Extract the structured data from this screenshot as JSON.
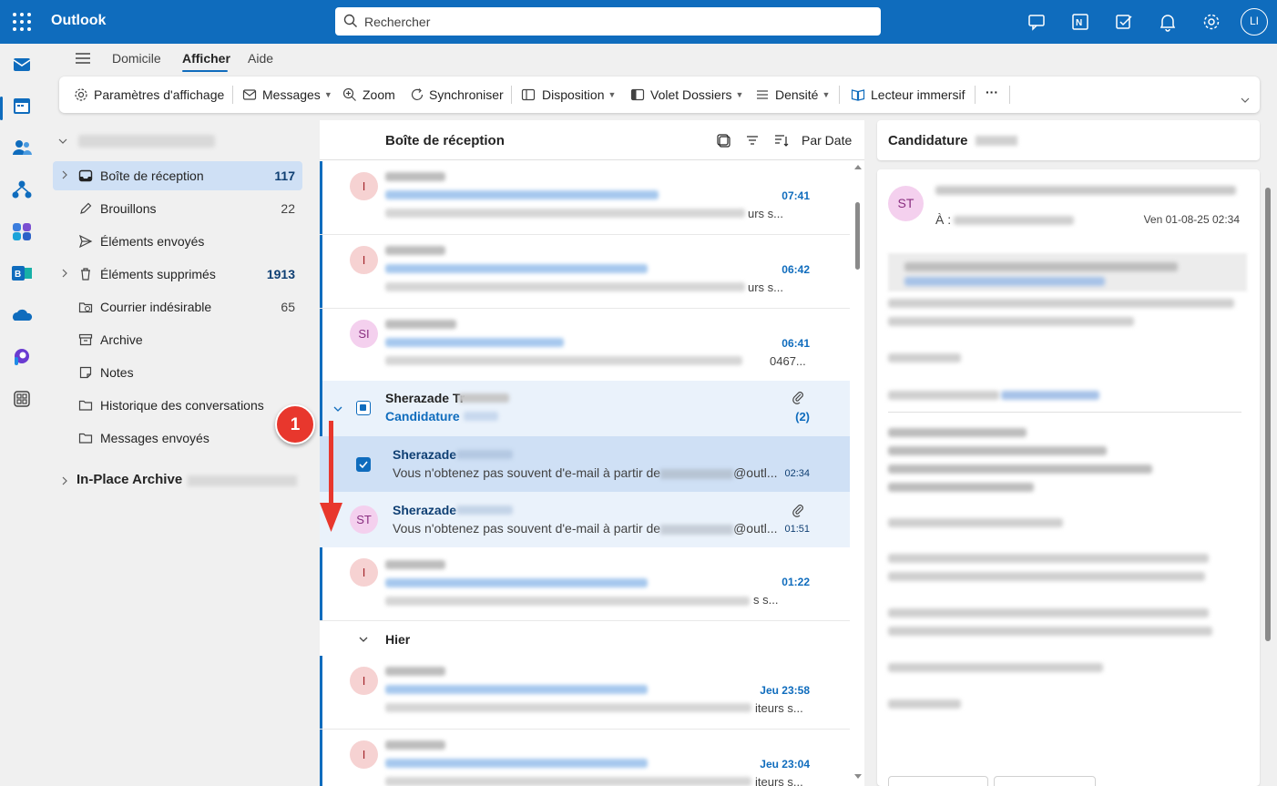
{
  "topbar": {
    "app_name": "Outlook",
    "search_placeholder": "Rechercher",
    "avatar_initials": "LI"
  },
  "ribbon": {
    "tabs": [
      "Domicile",
      "Afficher",
      "Aide"
    ],
    "active_tab": "Afficher"
  },
  "toolbar": {
    "view_settings": "Paramètres d'affichage",
    "messages": "Messages",
    "zoom": "Zoom",
    "sync": "Synchroniser",
    "layout": "Disposition",
    "folder_pane": "Volet Dossiers",
    "density": "Densité",
    "immersive_reader": "Lecteur immersif",
    "more": "···"
  },
  "folders": [
    {
      "label": "Boîte de réception",
      "count": "117",
      "selected": true
    },
    {
      "label": "Brouillons",
      "count": "22"
    },
    {
      "label": "Éléments envoyés",
      "count": ""
    },
    {
      "label": "Éléments supprimés",
      "count": "1913"
    },
    {
      "label": "Courrier indésirable",
      "count": "65"
    },
    {
      "label": "Archive",
      "count": ""
    },
    {
      "label": "Notes",
      "count": ""
    },
    {
      "label": "Historique des conversations",
      "count": ""
    },
    {
      "label": "Messages envoyés",
      "count": ""
    }
  ],
  "in_place_archive": "In-Place Archive",
  "list": {
    "title": "Boîte de réception",
    "sort": "Par Date",
    "messages": [
      {
        "avatar": "I",
        "time": "07:41",
        "tail": "urs s..."
      },
      {
        "avatar": "I",
        "time": "06:42",
        "tail": "urs s..."
      },
      {
        "avatar": "SI",
        "time": "06:41",
        "tail": "0467..."
      }
    ],
    "conversation": {
      "sender": "Sherazade Tr",
      "subject": "Candidature",
      "count": "(2)",
      "children": [
        {
          "name": "Sherazade",
          "preview_start": "Vous n'obtenez pas souvent d'e-mail à partir de",
          "preview_end": "@outl...",
          "time": "02:34"
        },
        {
          "name": "Sherazade",
          "avatar": "ST",
          "preview_start": "Vous n'obtenez pas souvent d'e-mail à partir de",
          "preview_end": "@outl...",
          "time": "01:51"
        }
      ]
    },
    "after": {
      "avatar": "I",
      "time": "01:22",
      "tail": "s s..."
    },
    "group_yesterday": "Hier",
    "yesterday": [
      {
        "avatar": "I",
        "time": "Jeu 23:58",
        "tail": "iteurs s..."
      },
      {
        "avatar": "I",
        "time": "Jeu 23:04",
        "tail": "iteurs s..."
      }
    ]
  },
  "annotation": {
    "number": "1"
  },
  "reading": {
    "title": "Candidature",
    "avatar": "ST",
    "to_label": "À :",
    "date": "Ven 01-08-25 02:34"
  }
}
